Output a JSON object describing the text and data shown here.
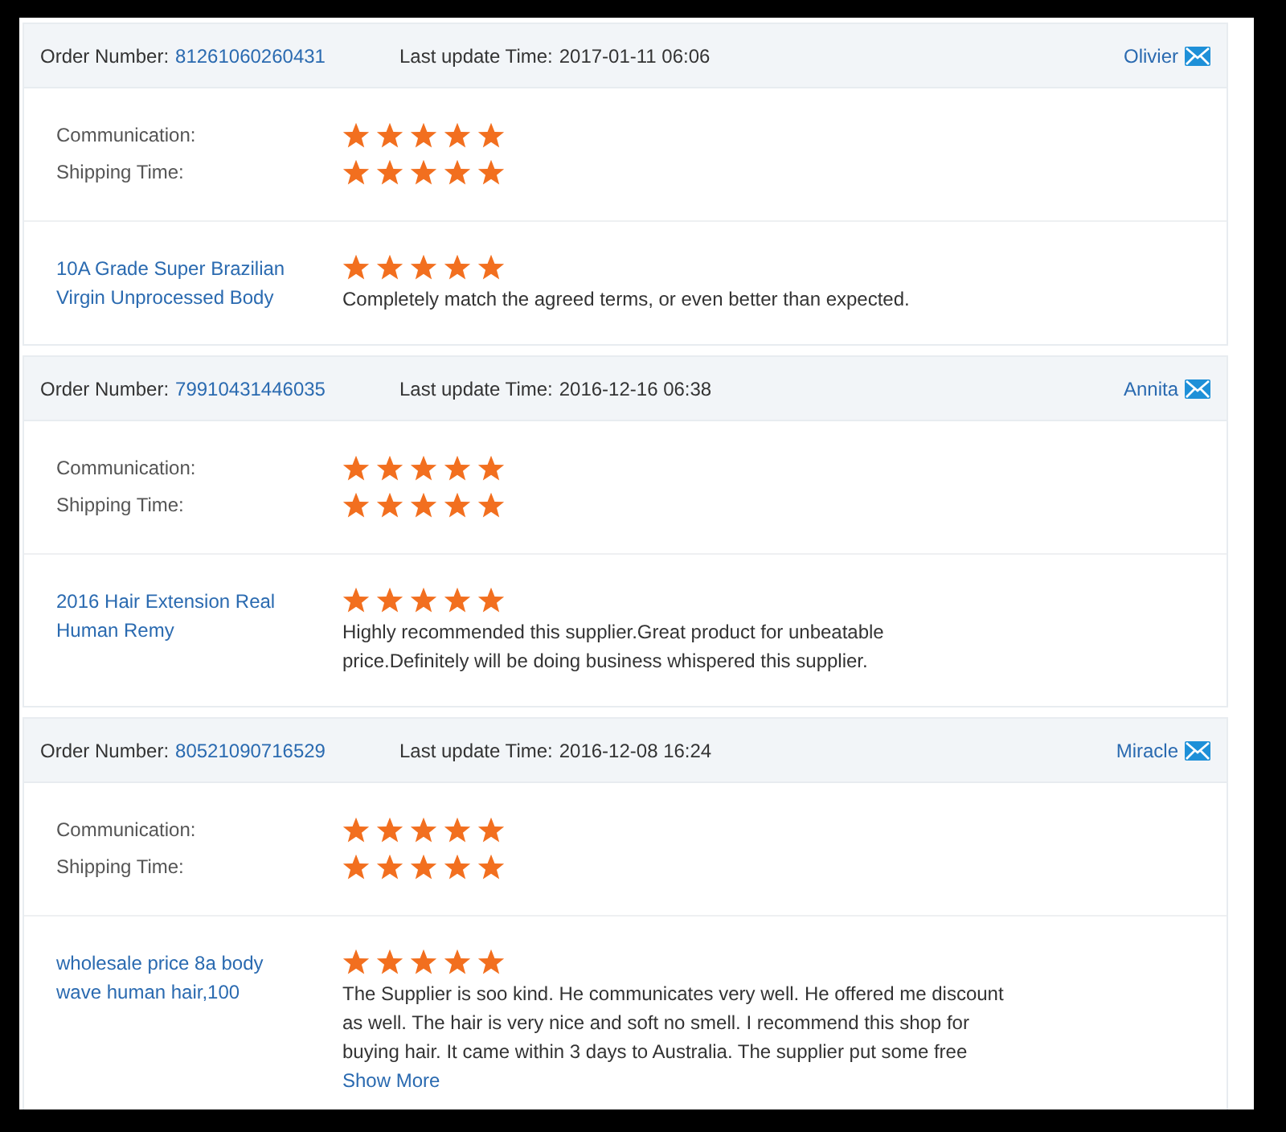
{
  "orders": [
    {
      "order_label": "Order Number:",
      "order_number": "81261060260431",
      "update_label": "Last update Time:",
      "update_time": "2017-01-11 06:06",
      "buyer": "Olivier",
      "ratings": [
        {
          "label": "Communication:",
          "stars": 5
        },
        {
          "label": "Shipping Time:",
          "stars": 5
        }
      ],
      "product": "10A Grade Super Brazilian Virgin Unprocessed Body",
      "product_rating": {
        "stars": 5
      },
      "feedback": "Completely match the agreed terms, or even better than expected."
    },
    {
      "order_label": "Order Number:",
      "order_number": "79910431446035",
      "update_label": "Last update Time:",
      "update_time": "2016-12-16 06:38",
      "buyer": "Annita",
      "ratings": [
        {
          "label": "Communication:",
          "stars": 5
        },
        {
          "label": "Shipping Time:",
          "stars": 5
        }
      ],
      "product": "2016 Hair Extension Real Human Remy",
      "product_rating": {
        "stars": 5
      },
      "feedback": "Highly recommended this supplier.Great product for unbeatable price.Definitely will be doing business whispered this supplier."
    },
    {
      "order_label": "Order Number:",
      "order_number": "80521090716529",
      "update_label": "Last update Time:",
      "update_time": "2016-12-08 16:24",
      "buyer": "Miracle",
      "ratings": [
        {
          "label": "Communication:",
          "stars": 5
        },
        {
          "label": "Shipping Time:",
          "stars": 5
        }
      ],
      "product": "wholesale price 8a body wave human hair,100",
      "product_rating": {
        "stars": 5
      },
      "feedback": "The Supplier is soo kind. He communicates very well. He offered me discount as well. The hair is very nice and soft no smell. I recommend this shop for buying hair. It came within 3 days to Australia. The supplier put some free",
      "show_more": "Show More"
    }
  ]
}
